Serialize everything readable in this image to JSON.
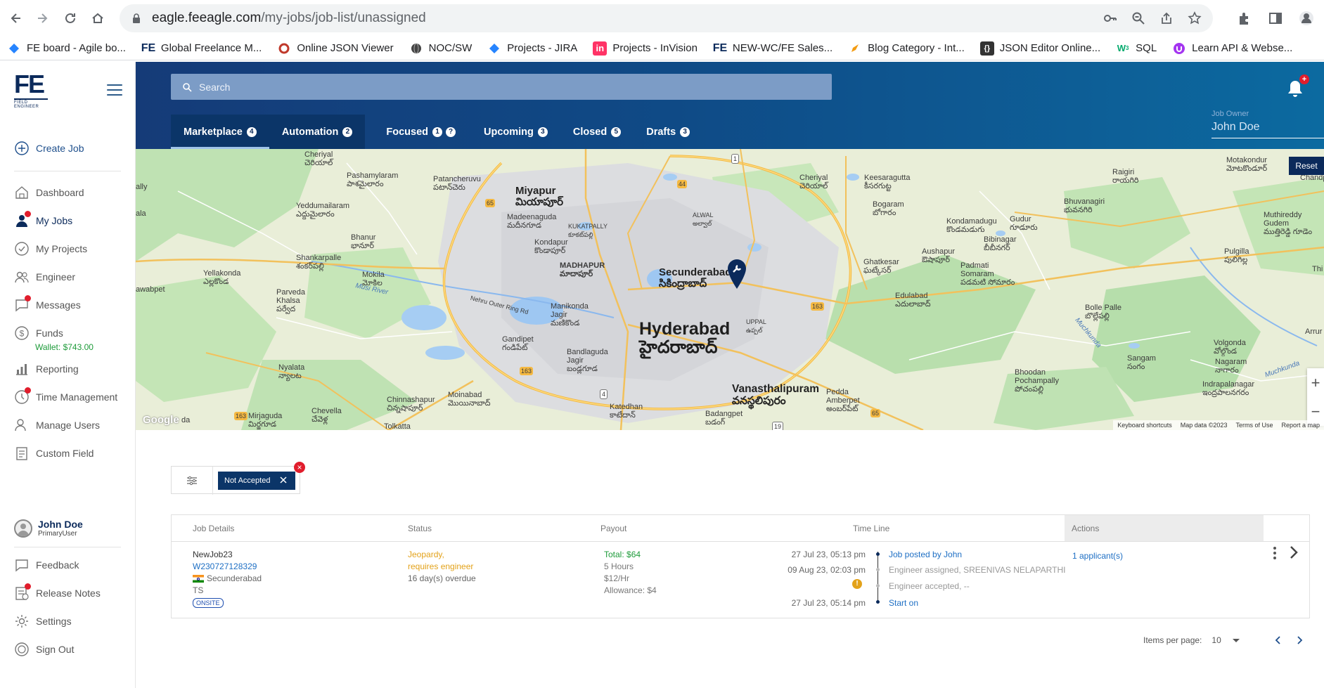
{
  "browser": {
    "url_host": "eagle.feeagle.com",
    "url_path": "/my-jobs/job-list/unassigned",
    "bookmarks": [
      {
        "label": "FE board - Agile bo...",
        "icon": "diamond-blue-icon"
      },
      {
        "label": "Global Freelance M...",
        "icon": "fe-logo-icon"
      },
      {
        "label": "Online JSON Viewer",
        "icon": "red-ring-icon"
      },
      {
        "label": "NOC/SW",
        "icon": "globe-dark-icon"
      },
      {
        "label": "Projects - JIRA",
        "icon": "diamond-blue-icon"
      },
      {
        "label": "Projects - InVision",
        "icon": "invision-icon"
      },
      {
        "label": "NEW-WC/FE Sales...",
        "icon": "fe-logo-icon"
      },
      {
        "label": "Blog Category - Int...",
        "icon": "pen-icon"
      },
      {
        "label": "JSON Editor Online...",
        "icon": "braces-icon"
      },
      {
        "label": "SQL",
        "icon": "w3-icon"
      },
      {
        "label": "Learn API & Webse...",
        "icon": "purple-u-icon"
      }
    ]
  },
  "sidebar": {
    "create_job": "Create Job",
    "items": [
      {
        "label": "Dashboard"
      },
      {
        "label": "My Jobs"
      },
      {
        "label": "My Projects"
      },
      {
        "label": "Engineer"
      },
      {
        "label": "Messages"
      },
      {
        "label": "Funds"
      },
      {
        "label": "Reporting"
      },
      {
        "label": "Time Management"
      },
      {
        "label": "Manage Users"
      },
      {
        "label": "Custom Field"
      }
    ],
    "wallet": "Wallet: $743.00",
    "user": {
      "name": "John Doe",
      "role": "PrimaryUser"
    },
    "bottom_items": [
      {
        "label": "Feedback"
      },
      {
        "label": "Release Notes"
      },
      {
        "label": "Settings"
      },
      {
        "label": "Sign Out"
      }
    ]
  },
  "header": {
    "search_placeholder": "Search",
    "notification_badge": "+",
    "tabs": [
      {
        "label": "Marketplace",
        "count": "4"
      },
      {
        "label": "Automation",
        "count": "2"
      },
      {
        "label": "Focused",
        "count": "1"
      },
      {
        "label": "Upcoming",
        "count": "3"
      },
      {
        "label": "Closed",
        "count": "5"
      },
      {
        "label": "Drafts",
        "count": "3"
      }
    ],
    "owner_label": "Job Owner",
    "owner_value": "John Doe"
  },
  "map": {
    "reset_label": "Reset",
    "google": "Google",
    "footer": {
      "shortcuts": "Keyboard shortcuts",
      "data": "Map data ©2023",
      "terms": "Terms of Use",
      "report": "Report a map"
    },
    "labels": {
      "miyapur": "Miyapur",
      "miyapur_te": "మియాపూర్",
      "secunderabad": "Secunderabad",
      "secunderabad_te": "సికింద్రాబాద్",
      "hyderabad": "Hyderabad",
      "hyderabad_te": "హైదరాబాద్",
      "vanasthalipuram": "Vanasthalipuram",
      "vanasthalipuram_te": "వనస్థలిపురం",
      "madhapur": "MADHAPUR",
      "madhapur_te": "మాదాపూర్",
      "kukatpally": "KUKATPALLY",
      "kukatpally_te": "కూకట్‌పల్లి",
      "alwal": "ALWAL",
      "alwal_te": "అల్వాల్",
      "uppal": "UPPAL",
      "uppal_te": "ఉప్పల్",
      "cheriyal": "Cheriyal",
      "cheriyal_te": "చెరియాల్",
      "pashamylaram": "Pashamylaram",
      "pashamylaram_te": "పాశమైలారం",
      "patancheruvu": "Patancheruvu",
      "patancheruvu_te": "పటాన్‌చెరు",
      "madeenaguda": "Madeenaguda",
      "madeenaguda_te": "మదీనగూడ",
      "yeddumailaram": "Yeddumailaram",
      "yeddumailaram_te": "ఎద్దుమైలారం",
      "bhanur": "Bhanur",
      "bhanur_te": "భానూర్",
      "kondapur": "Kondapur",
      "kondapur_te": "కొండాపూర్",
      "shankarpalle": "Shankarpalle",
      "shankarpalle_te": "శంకర్‌పల్లి",
      "yellakonda": "Yellakonda",
      "yellakonda_te": "ఎల్లకొండ",
      "mokila": "Mokila",
      "mokila_te": "మోకిల",
      "musi": "Musi River",
      "parveda": "Parveda",
      "khalsa": "Khalsa",
      "khalsa_te": "పర్వేద",
      "nehru": "Nehru Outer Ring Rd",
      "manikonda": "Manikonda",
      "manikonda_jagir": "Jagir",
      "manikonda_te": "మణికొండ",
      "gandipet": "Gandipet",
      "gandipet_te": "గండిపేట్",
      "bandlaguda": "Bandlaguda",
      "bandlaguda_jagir": "Jagir",
      "bandlaguda_te": "బండ్లగూడ",
      "nyalata": "Nyalata",
      "nyalata_te": "న్యాలట",
      "chinnashapur": "Chinnashapur",
      "chinnashapur_te": "చిన్నషాపూర్",
      "moinabad": "Moinabad",
      "moinabad_te": "మొయినాబాద్",
      "katedhan": "Katedhan",
      "katedhan_te": "కాటేదాన్",
      "mirjaguda": "Mirjaguda",
      "mirjaguda_te": "మిర్జగూడ",
      "chevella": "Chevella",
      "chevella_te": "చేవెళ్ల",
      "tolkatta": "Tolkatta",
      "badangpet": "Badangpet",
      "badangpet_te": "బడంగ్",
      "pedda_amberpet": "Pedda",
      "amberpet": "Amberpet",
      "amberpet_te": "అంబర్‌పేట్",
      "keesaragutta": "Keesaragutta",
      "keesaragutta_te": "కీసరగుట్ట",
      "bogaram": "Bogaram",
      "bogaram_te": "బోగారం",
      "ghatkesar": "Ghatkesar",
      "ghatkesar_te": "ఘట్కేసర్",
      "edulabad": "Edulabad",
      "edulabad_te": "ఎదులాబాద్",
      "aushapur": "Aushapur",
      "aushapur_te": "ఔషాపూర్",
      "kondamadugu": "Kondamadugu",
      "kondamadugu_te": "కొండమడుగు",
      "gudur": "Gudur",
      "gudur_te": "గూడూరు",
      "bibinagar": "Bibinagar",
      "bibinagar_te": "బీబీనగర్",
      "padmati": "Padmati",
      "somaram": "Somaram",
      "somaram_te": "పడమటి సోమారం",
      "bhuvanagiri": "Bhuvanagiri",
      "bhuvanagiri_te": "భువనగిరి",
      "raigiri": "Raigiri",
      "raigiri_te": "రాయగిరి",
      "motakondur": "Motakondur",
      "motakondur_te": "మోటకొండూర్",
      "muthireddy": "Muthireddy",
      "gudem": "Gudem",
      "gudem_te": "ముత్తిరెడ్డి గూడెం",
      "pulgilla": "Pulgilla",
      "pulgilla_te": "పులిగిల్ల",
      "bolle_palle": "Bolle Palle",
      "bolle_palle_te": "బొల్లేపల్లి",
      "volgonda": "Volgonda",
      "volgonda_te": "వోల్గొండ",
      "nagaram": "Nagaram",
      "nagaram_te": "నాగారం",
      "sangam": "Sangam",
      "sangam_te": "సంగం",
      "bhoodan": "Bhoodan",
      "pochampally": "Pochampally",
      "pochampally_te": "పోచంపల్లి",
      "indrapalanagar": "Indrapalanagar",
      "indrapalanagar_te": "ఇంద్రపాలనగరం",
      "muchkunda": "Muchkunda",
      "arrur": "Arrur",
      "thi": "Thi",
      "ally": "ally",
      "ala": "ala",
      "awabpet": "awabpet",
      "da": "da",
      "chandpe": "Chandpe",
      "r65a": "65",
      "r44": "44",
      "r1": "1",
      "r163a": "163",
      "r163b": "163",
      "r163c": "163",
      "r4": "4",
      "r65b": "65",
      "r19": "19"
    }
  },
  "filter": {
    "chip_label": "Not Accepted",
    "remove": "×"
  },
  "table": {
    "headers": {
      "details": "Job Details",
      "status": "Status",
      "payout": "Payout",
      "timeline": "Time Line",
      "actions": "Actions"
    },
    "rows": [
      {
        "name": "NewJob23",
        "id": "W230727128329",
        "city": "Secunderabad",
        "state": "TS",
        "tag": "ONSITE",
        "status_line1": "Jeopardy,",
        "status_line2": "requires engineer",
        "overdue": "16 day(s) overdue",
        "total": "Total: $64",
        "hours": "5 Hours",
        "rate": "$12/Hr",
        "allowance": "Allowance: $4",
        "timeline": [
          {
            "date": "27 Jul 23, 05:13 pm",
            "event": "Job posted by John"
          },
          {
            "date": "09 Aug 23, 02:03 pm",
            "event": "Engineer assigned, SREENIVAS NELAPARTHI"
          },
          {
            "date": "",
            "event": "Engineer accepted, --"
          },
          {
            "date": "27 Jul 23, 05:14 pm",
            "event": "Start on"
          }
        ],
        "warn_icon": "!",
        "applicants": "1 applicant(s)"
      }
    ]
  },
  "pager": {
    "label": "Items per page:",
    "value": "10"
  }
}
